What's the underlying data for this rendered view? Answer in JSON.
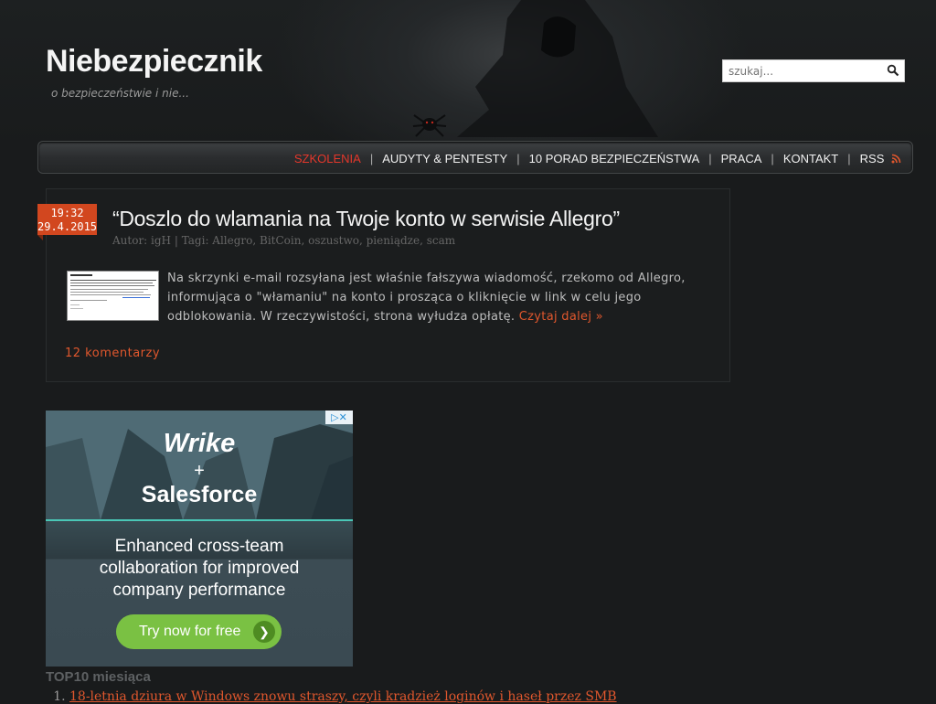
{
  "site": {
    "title": "Niebezpiecznik",
    "tagline": "o bezpieczeństwie i nie..."
  },
  "search": {
    "placeholder": "szukaj...",
    "icon": "search-icon"
  },
  "nav": {
    "items": [
      {
        "label": "SZKOLENIA",
        "active": true
      },
      {
        "label": "AUDYTY & PENTESTY",
        "active": false
      },
      {
        "label": "10 PORAD BEZPIECZEŃSTWA",
        "active": false
      },
      {
        "label": "PRACA",
        "active": false
      },
      {
        "label": "KONTAKT",
        "active": false
      },
      {
        "label": "RSS",
        "active": false
      }
    ]
  },
  "post": {
    "time": "19:32",
    "date": "29.4.2015",
    "title": "“Doszlo do wlamania na Twoje konto w serwisie Allegro”",
    "meta": "Autor: igH | Tagi: Allegro, BitCoin, oszustwo, pieniądze, scam",
    "excerpt": "Na skrzynki e-mail rozsyłana jest właśnie fałszywa wiadomość, rzekomo od Allegro, informująca o \"włamaniu\" na konto i prosząca o kliknięcie w link w celu jego odblokowania. W rzeczywistości, strona wyłudza opłatę.",
    "read_more": "Czytaj dalej »",
    "comments": "12 komentarzy"
  },
  "ad": {
    "brand1": "Wrike",
    "plus": "+",
    "brand2": "Salesforce",
    "copy": "Enhanced cross-team collaboration for improved company performance",
    "cta": "Try now for free",
    "adchoices": "▷✕"
  },
  "sidebar": {
    "top10_heading": "TOP10 miesiąca",
    "top10": [
      "18-letnia dziura w Windows znowu straszy, czyli kradzież loginów i haseł przez SMB"
    ]
  },
  "colors": {
    "accent": "#e0572d",
    "nav_active": "#e4372b",
    "background": "#191b1c"
  }
}
